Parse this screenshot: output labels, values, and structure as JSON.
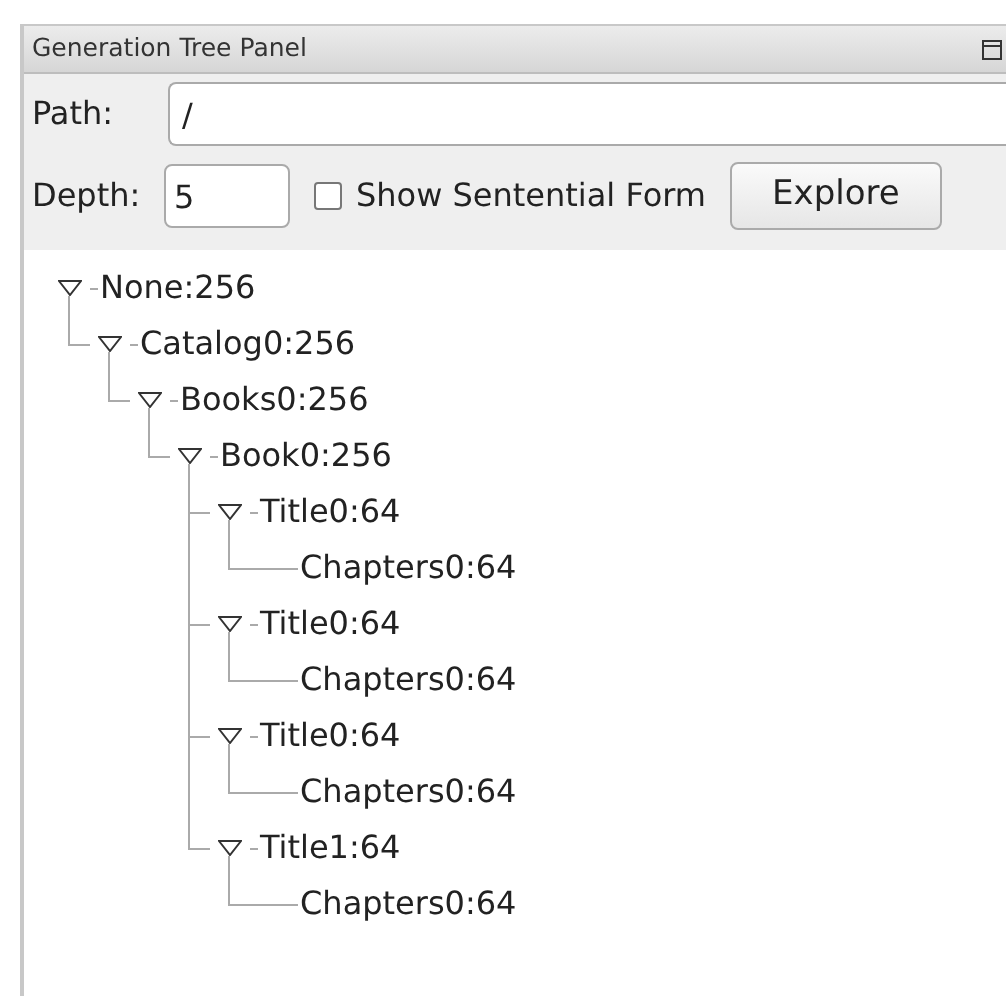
{
  "panel": {
    "title": "Generation Tree Panel"
  },
  "path": {
    "label": "Path:",
    "value": "/"
  },
  "depth": {
    "label": "Depth:",
    "value": "5"
  },
  "show_sentential_form": {
    "label": "Show Sentential Form",
    "checked": false
  },
  "explore_button": "Explore",
  "tree": [
    {
      "label": "None:256",
      "expanded": true,
      "children": [
        {
          "label": "Catalog0:256",
          "expanded": true,
          "children": [
            {
              "label": "Books0:256",
              "expanded": true,
              "children": [
                {
                  "label": "Book0:256",
                  "expanded": true,
                  "children": [
                    {
                      "label": "Title0:64",
                      "expanded": true,
                      "children": [
                        {
                          "label": "Chapters0:64"
                        }
                      ]
                    },
                    {
                      "label": "Title0:64",
                      "expanded": true,
                      "children": [
                        {
                          "label": "Chapters0:64"
                        }
                      ]
                    },
                    {
                      "label": "Title0:64",
                      "expanded": true,
                      "children": [
                        {
                          "label": "Chapters0:64"
                        }
                      ]
                    },
                    {
                      "label": "Title1:64",
                      "expanded": true,
                      "children": [
                        {
                          "label": "Chapters0:64"
                        }
                      ]
                    }
                  ]
                }
              ]
            }
          ]
        }
      ]
    }
  ]
}
